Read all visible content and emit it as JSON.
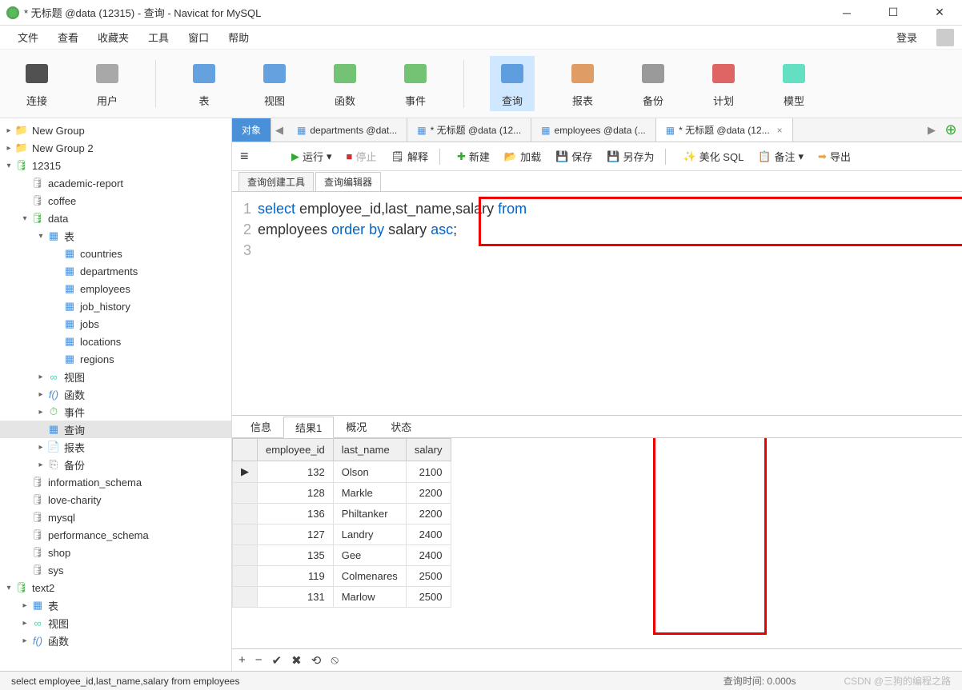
{
  "window": {
    "title": "* 无标题 @data (12315) - 查询 - Navicat for MySQL",
    "login_label": "登录"
  },
  "menu": [
    "文件",
    "查看",
    "收藏夹",
    "工具",
    "窗口",
    "帮助"
  ],
  "toolbar": [
    {
      "key": "connect",
      "label": "连接"
    },
    {
      "key": "user",
      "label": "用户"
    },
    {
      "key": "table",
      "label": "表"
    },
    {
      "key": "view",
      "label": "视图"
    },
    {
      "key": "function",
      "label": "函数"
    },
    {
      "key": "event",
      "label": "事件"
    },
    {
      "key": "query",
      "label": "查询",
      "active": true
    },
    {
      "key": "report",
      "label": "报表"
    },
    {
      "key": "backup",
      "label": "备份"
    },
    {
      "key": "plan",
      "label": "计划"
    },
    {
      "key": "model",
      "label": "模型"
    }
  ],
  "tree": [
    {
      "ind": 0,
      "tog": ">",
      "icon": "folder",
      "label": "New Group"
    },
    {
      "ind": 0,
      "tog": ">",
      "icon": "folder",
      "label": "New Group 2"
    },
    {
      "ind": 0,
      "tog": "v",
      "icon": "db",
      "label": "12315"
    },
    {
      "ind": 1,
      "tog": "",
      "icon": "gdb",
      "label": "academic-report"
    },
    {
      "ind": 1,
      "tog": "",
      "icon": "gdb",
      "label": "coffee"
    },
    {
      "ind": 1,
      "tog": "v",
      "icon": "db",
      "label": "data"
    },
    {
      "ind": 2,
      "tog": "v",
      "icon": "tbl",
      "label": "表"
    },
    {
      "ind": 3,
      "tog": "",
      "icon": "tbl",
      "label": "countries"
    },
    {
      "ind": 3,
      "tog": "",
      "icon": "tbl",
      "label": "departments"
    },
    {
      "ind": 3,
      "tog": "",
      "icon": "tbl",
      "label": "employees"
    },
    {
      "ind": 3,
      "tog": "",
      "icon": "tbl",
      "label": "job_history"
    },
    {
      "ind": 3,
      "tog": "",
      "icon": "tbl",
      "label": "jobs"
    },
    {
      "ind": 3,
      "tog": "",
      "icon": "tbl",
      "label": "locations"
    },
    {
      "ind": 3,
      "tog": "",
      "icon": "tbl",
      "label": "regions"
    },
    {
      "ind": 2,
      "tog": ">",
      "icon": "view",
      "label": "视图"
    },
    {
      "ind": 2,
      "tog": ">",
      "icon": "fn",
      "label": "函数"
    },
    {
      "ind": 2,
      "tog": ">",
      "icon": "ev",
      "label": "事件"
    },
    {
      "ind": 2,
      "tog": "",
      "icon": "qry",
      "label": "查询",
      "sel": true
    },
    {
      "ind": 2,
      "tog": ">",
      "icon": "rpt",
      "label": "报表"
    },
    {
      "ind": 2,
      "tog": ">",
      "icon": "bak",
      "label": "备份"
    },
    {
      "ind": 1,
      "tog": "",
      "icon": "gdb",
      "label": "information_schema"
    },
    {
      "ind": 1,
      "tog": "",
      "icon": "gdb",
      "label": "love-charity"
    },
    {
      "ind": 1,
      "tog": "",
      "icon": "gdb",
      "label": "mysql"
    },
    {
      "ind": 1,
      "tog": "",
      "icon": "gdb",
      "label": "performance_schema"
    },
    {
      "ind": 1,
      "tog": "",
      "icon": "gdb",
      "label": "shop"
    },
    {
      "ind": 1,
      "tog": "",
      "icon": "gdb",
      "label": "sys"
    },
    {
      "ind": 0,
      "tog": "v",
      "icon": "db",
      "label": "text2"
    },
    {
      "ind": 1,
      "tog": ">",
      "icon": "tbl",
      "label": "表"
    },
    {
      "ind": 1,
      "tog": ">",
      "icon": "view",
      "label": "视图"
    },
    {
      "ind": 1,
      "tog": ">",
      "icon": "fn",
      "label": "函数"
    }
  ],
  "content_tabs": {
    "objects": "对象",
    "items": [
      {
        "label": "departments @dat..."
      },
      {
        "label": "* 无标题 @data (12..."
      },
      {
        "label": "employees @data (..."
      },
      {
        "label": "* 无标题 @data (12...",
        "active": true
      }
    ]
  },
  "qtoolbar": {
    "run": "运行",
    "stop": "停止",
    "explain": "解释",
    "new": "新建",
    "load": "加载",
    "save": "保存",
    "saveas": "另存为",
    "beautify": "美化 SQL",
    "note": "备注",
    "export": "导出"
  },
  "subtabs": {
    "builder": "查询创建工具",
    "editor": "查询编辑器"
  },
  "sql_lines": [
    [
      {
        "t": "select",
        "k": 1
      },
      {
        "t": " employee_id,last_name,salary "
      },
      {
        "t": "from",
        "k": 1
      }
    ],
    [
      {
        "t": "employees "
      },
      {
        "t": "order by",
        "k": 1
      },
      {
        "t": " salary "
      },
      {
        "t": "asc",
        "k": 1
      },
      {
        "t": ";"
      }
    ]
  ],
  "result_tabs": [
    "信息",
    "结果1",
    "概况",
    "状态"
  ],
  "result_active": 1,
  "columns": [
    "employee_id",
    "last_name",
    "salary"
  ],
  "rows": [
    {
      "employee_id": 132,
      "last_name": "Olson",
      "salary": 2100,
      "ptr": true
    },
    {
      "employee_id": 128,
      "last_name": "Markle",
      "salary": 2200
    },
    {
      "employee_id": 136,
      "last_name": "Philtanker",
      "salary": 2200
    },
    {
      "employee_id": 127,
      "last_name": "Landry",
      "salary": 2400
    },
    {
      "employee_id": 135,
      "last_name": "Gee",
      "salary": 2400
    },
    {
      "employee_id": 119,
      "last_name": "Colmenares",
      "salary": 2500
    },
    {
      "employee_id": 131,
      "last_name": "Marlow",
      "salary": 2500
    }
  ],
  "status": {
    "sql": "select employee_id,last_name,salary from employees",
    "time": "查询时间: 0.000s",
    "watermark": "CSDN @三狗的编程之路"
  }
}
